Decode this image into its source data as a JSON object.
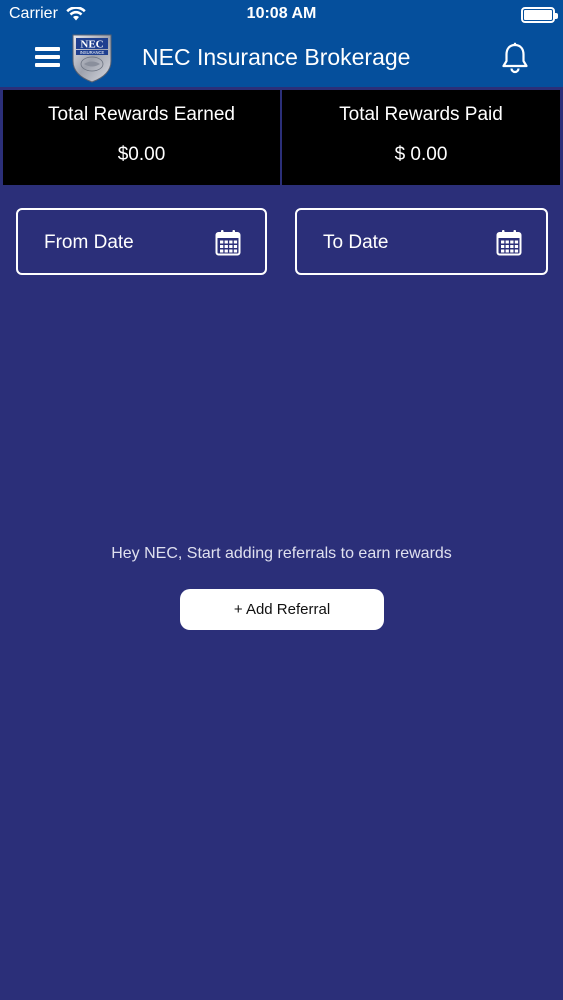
{
  "status_bar": {
    "carrier": "Carrier",
    "time": "10:08 AM",
    "battery_level": 1.0
  },
  "nav": {
    "title": "NEC Insurance Brokerage",
    "menu_icon": "hamburger-menu-icon",
    "bell_icon": "bell-icon",
    "logo_text": "NEC",
    "logo_subtext": "INSURANCE"
  },
  "rewards": {
    "earned_label": "Total Rewards Earned",
    "earned_value": "$0.00",
    "paid_label": "Total Rewards Paid",
    "paid_value": "$ 0.00"
  },
  "filters": {
    "from_date_placeholder": "From Date",
    "to_date_placeholder": "To Date",
    "calendar_icon": "calendar-icon"
  },
  "empty_state": {
    "message": "Hey NEC, Start adding referrals to earn rewards",
    "add_button": "+ Add Referral"
  },
  "colors": {
    "header_bg": "#054f9c",
    "page_bg": "#2b2f79",
    "card_bg": "#000000",
    "button_bg": "#ffffff"
  }
}
